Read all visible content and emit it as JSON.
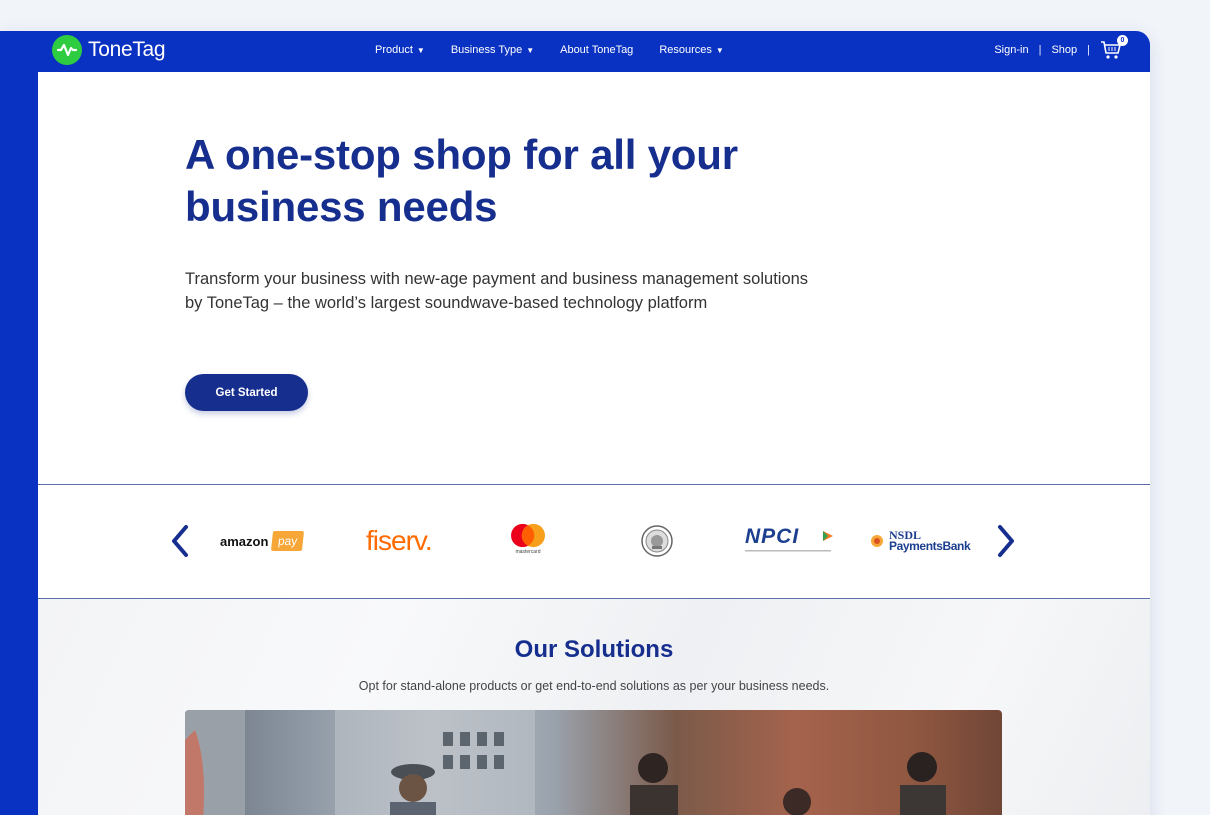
{
  "brand": {
    "name": "ToneTag",
    "logo_color": "#2ecc40"
  },
  "nav": {
    "items": [
      {
        "label": "Product",
        "has_dropdown": true
      },
      {
        "label": "Business Type",
        "has_dropdown": true
      },
      {
        "label": "About ToneTag",
        "has_dropdown": false
      },
      {
        "label": "Resources",
        "has_dropdown": true
      }
    ],
    "signin": "Sign-in",
    "separator": "|",
    "shop": "Shop",
    "cart_count": "0"
  },
  "hero": {
    "title": "A one-stop shop for all your business needs",
    "description": "Transform your business with new-age payment and business management solutions by ToneTag – the world’s largest soundwave-based technology platform",
    "cta": "Get Started"
  },
  "partners": {
    "logos": [
      {
        "name": "amazon pay",
        "word": "amazon",
        "badge": "pay"
      },
      {
        "name": "fiserv",
        "word": "fiserv."
      },
      {
        "name": "mastercard",
        "word": "mastercard"
      },
      {
        "name": "rbi-seal"
      },
      {
        "name": "npci",
        "word": "NPCI"
      },
      {
        "name": "nsdl-payments-bank",
        "word": "NSDL",
        "badge": "PaymentsBank"
      }
    ]
  },
  "solutions": {
    "title": "Our Solutions",
    "subtitle": "Opt for stand-alone products or get end-to-end solutions as per your business needs."
  },
  "colors": {
    "navbar": "#0a32c2",
    "heading": "#162e8e",
    "accent_orange": "#ff6b00"
  }
}
